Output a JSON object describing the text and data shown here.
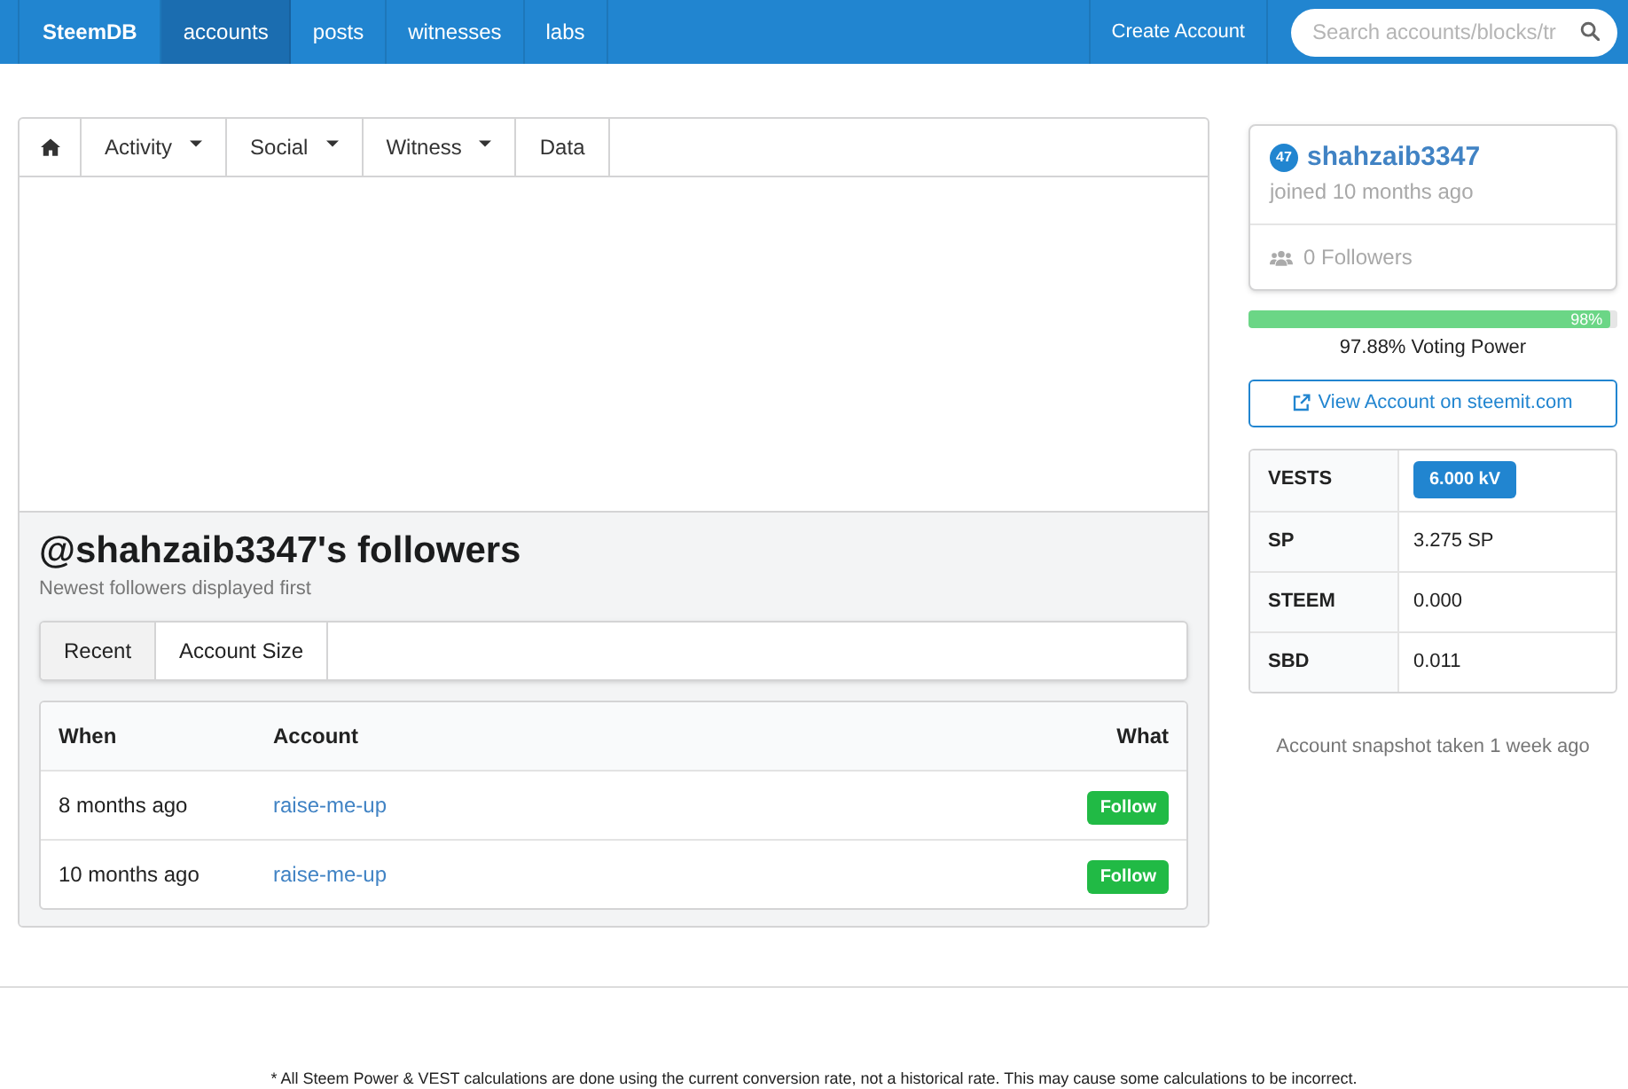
{
  "navbar": {
    "brand": "SteemDB",
    "items": [
      {
        "label": "accounts",
        "selected": true
      },
      {
        "label": "posts",
        "selected": false
      },
      {
        "label": "witnesses",
        "selected": false
      },
      {
        "label": "labs",
        "selected": false
      }
    ],
    "create_account": "Create Account",
    "search": {
      "placeholder": "Search accounts/blocks/tr"
    }
  },
  "account_tabs": [
    {
      "kind": "home"
    },
    {
      "label": "Activity",
      "kind": "dropdown"
    },
    {
      "label": "Social",
      "kind": "dropdown"
    },
    {
      "label": "Witness",
      "kind": "dropdown"
    },
    {
      "label": "Data",
      "kind": "link"
    }
  ],
  "followers": {
    "title": "@shahzaib3347's followers",
    "subtitle": "Newest followers displayed first",
    "tabs": [
      {
        "label": "Recent",
        "selected": true
      },
      {
        "label": "Account Size",
        "selected": false
      }
    ],
    "table": {
      "columns": [
        "When",
        "Account",
        "What"
      ],
      "rows": [
        {
          "when": "8 months ago",
          "account": "raise-me-up",
          "what": "Follow"
        },
        {
          "when": "10 months ago",
          "account": "raise-me-up",
          "what": "Follow"
        }
      ]
    }
  },
  "profile": {
    "reputation": "47",
    "name": "shahzaib3347",
    "joined": "joined 10 months ago",
    "followers": "0 Followers"
  },
  "voting_power": {
    "level": 0.9788,
    "bar_label": "98%",
    "reading": "97.88% Voting Power"
  },
  "view_account_button": "View Account on steemit.com",
  "balances": [
    {
      "label": "VESTS",
      "value": "6.000 kV",
      "kind": "badge"
    },
    {
      "label": "SP",
      "value": "3.275 SP",
      "kind": "text"
    },
    {
      "label": "STEEM",
      "value": "0.000",
      "kind": "text"
    },
    {
      "label": "SBD",
      "value": "0.011",
      "kind": "text"
    }
  ],
  "snapshot_note": "Account snapshot taken 1 week ago",
  "footer_note": "* All Steem Power & VEST calculations are done using the current conversion rate, not a historical rate. This may cause some calculations to be incorrect."
}
